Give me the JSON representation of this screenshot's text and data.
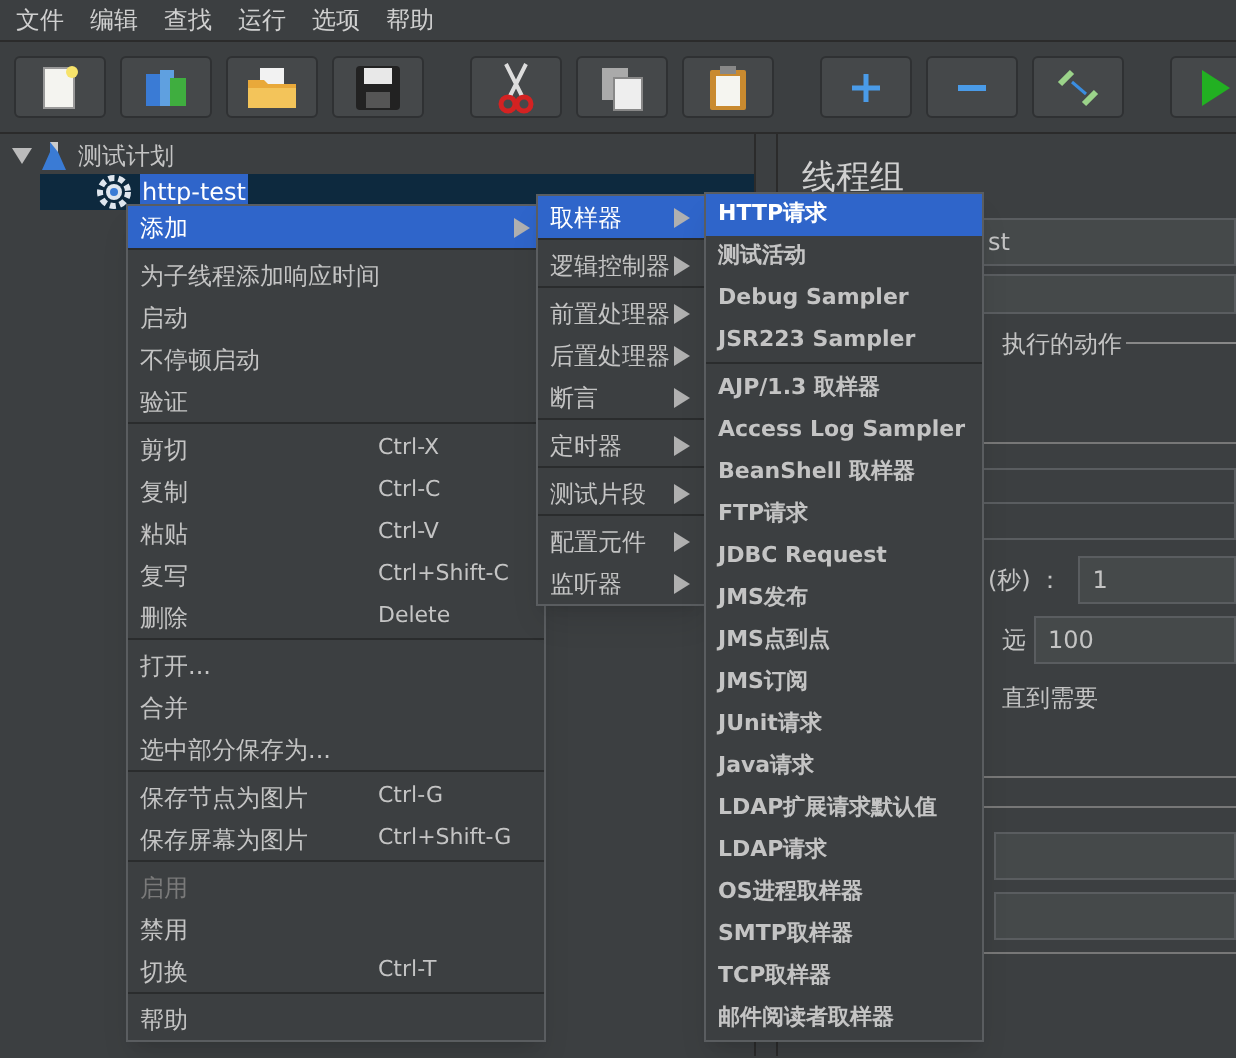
{
  "menubar": [
    "文件",
    "编辑",
    "查找",
    "运行",
    "选项",
    "帮助"
  ],
  "tree": [
    {
      "label": "测试计划",
      "kind": "plan",
      "expanded": true,
      "selected": false,
      "children": [
        {
          "label": "http-test",
          "kind": "threads",
          "selected": true
        }
      ]
    }
  ],
  "right_panel": {
    "title": "线程组",
    "name_field": {
      "value": "st"
    },
    "action_label": "执行的动作",
    "ramp_label": "(秒) ：",
    "ramp_field": {
      "value": "1"
    },
    "loop_label": "远",
    "loop_field": {
      "value": "100"
    },
    "delay_label": "直到需要"
  },
  "context_menu": {
    "groups": [
      [
        {
          "label": "添加",
          "has_submenu": true,
          "selected": true,
          "disabled": false
        }
      ],
      [
        {
          "label": "为子线程添加响应时间",
          "has_submenu": false,
          "selected": false,
          "disabled": false
        },
        {
          "label": "启动",
          "has_submenu": false,
          "selected": false,
          "disabled": false
        },
        {
          "label": "不停顿启动",
          "has_submenu": false,
          "selected": false,
          "disabled": false
        },
        {
          "label": "验证",
          "has_submenu": false,
          "selected": false,
          "disabled": false
        }
      ],
      [
        {
          "label": "剪切",
          "shortcut": "Ctrl-X",
          "has_submenu": false,
          "selected": false,
          "disabled": false
        },
        {
          "label": "复制",
          "shortcut": "Ctrl-C",
          "has_submenu": false,
          "selected": false,
          "disabled": false
        },
        {
          "label": "粘贴",
          "shortcut": "Ctrl-V",
          "has_submenu": false,
          "selected": false,
          "disabled": false
        },
        {
          "label": "复写",
          "shortcut": "Ctrl+Shift-C",
          "has_submenu": false,
          "selected": false,
          "disabled": false
        },
        {
          "label": "删除",
          "shortcut": "Delete",
          "has_submenu": false,
          "selected": false,
          "disabled": false
        }
      ],
      [
        {
          "label": "打开...",
          "has_submenu": false,
          "selected": false,
          "disabled": false
        },
        {
          "label": "合并",
          "has_submenu": false,
          "selected": false,
          "disabled": false
        },
        {
          "label": "选中部分保存为...",
          "has_submenu": false,
          "selected": false,
          "disabled": false
        }
      ],
      [
        {
          "label": "保存节点为图片",
          "shortcut": "Ctrl-G",
          "has_submenu": false,
          "selected": false,
          "disabled": false
        },
        {
          "label": "保存屏幕为图片",
          "shortcut": "Ctrl+Shift-G",
          "has_submenu": false,
          "selected": false,
          "disabled": false
        }
      ],
      [
        {
          "label": "启用",
          "has_submenu": false,
          "selected": false,
          "disabled": true
        },
        {
          "label": "禁用",
          "has_submenu": false,
          "selected": false,
          "disabled": false
        },
        {
          "label": "切换",
          "shortcut": "Ctrl-T",
          "has_submenu": false,
          "selected": false,
          "disabled": false
        }
      ],
      [
        {
          "label": "帮助",
          "has_submenu": false,
          "selected": false,
          "disabled": false
        }
      ]
    ]
  },
  "add_submenu": {
    "groups": [
      [
        {
          "label": "取样器",
          "has_submenu": true,
          "selected": true,
          "disabled": false
        }
      ],
      [
        {
          "label": "逻辑控制器",
          "has_submenu": true,
          "selected": false,
          "disabled": false
        }
      ],
      [
        {
          "label": "前置处理器",
          "has_submenu": true,
          "selected": false,
          "disabled": false
        },
        {
          "label": "后置处理器",
          "has_submenu": true,
          "selected": false,
          "disabled": false
        },
        {
          "label": "断言",
          "has_submenu": true,
          "selected": false,
          "disabled": false
        }
      ],
      [
        {
          "label": "定时器",
          "has_submenu": true,
          "selected": false,
          "disabled": false
        }
      ],
      [
        {
          "label": "测试片段",
          "has_submenu": true,
          "selected": false,
          "disabled": false
        }
      ],
      [
        {
          "label": "配置元件",
          "has_submenu": true,
          "selected": false,
          "disabled": false
        },
        {
          "label": "监听器",
          "has_submenu": true,
          "selected": false,
          "disabled": false
        }
      ]
    ]
  },
  "sampler_submenu": {
    "groups": [
      [
        {
          "label": "HTTP请求",
          "has_submenu": false,
          "selected": true,
          "disabled": false
        },
        {
          "label": "测试活动",
          "has_submenu": false,
          "selected": false,
          "disabled": false
        },
        {
          "label": "Debug Sampler",
          "has_submenu": false,
          "selected": false,
          "disabled": false
        },
        {
          "label": "JSR223 Sampler",
          "has_submenu": false,
          "selected": false,
          "disabled": false
        }
      ],
      [
        {
          "label": "AJP/1.3 取样器",
          "has_submenu": false,
          "selected": false,
          "disabled": false
        },
        {
          "label": "Access Log Sampler",
          "has_submenu": false,
          "selected": false,
          "disabled": false
        },
        {
          "label": "BeanShell 取样器",
          "has_submenu": false,
          "selected": false,
          "disabled": false
        },
        {
          "label": "FTP请求",
          "has_submenu": false,
          "selected": false,
          "disabled": false
        },
        {
          "label": "JDBC Request",
          "has_submenu": false,
          "selected": false,
          "disabled": false
        },
        {
          "label": "JMS发布",
          "has_submenu": false,
          "selected": false,
          "disabled": false
        },
        {
          "label": "JMS点到点",
          "has_submenu": false,
          "selected": false,
          "disabled": false
        },
        {
          "label": "JMS订阅",
          "has_submenu": false,
          "selected": false,
          "disabled": false
        },
        {
          "label": "JUnit请求",
          "has_submenu": false,
          "selected": false,
          "disabled": false
        },
        {
          "label": "Java请求",
          "has_submenu": false,
          "selected": false,
          "disabled": false
        },
        {
          "label": "LDAP扩展请求默认值",
          "has_submenu": false,
          "selected": false,
          "disabled": false
        },
        {
          "label": "LDAP请求",
          "has_submenu": false,
          "selected": false,
          "disabled": false
        },
        {
          "label": "OS进程取样器",
          "has_submenu": false,
          "selected": false,
          "disabled": false
        },
        {
          "label": "SMTP取样器",
          "has_submenu": false,
          "selected": false,
          "disabled": false
        },
        {
          "label": "TCP取样器",
          "has_submenu": false,
          "selected": false,
          "disabled": false
        },
        {
          "label": "邮件阅读者取样器",
          "has_submenu": false,
          "selected": false,
          "disabled": false
        }
      ]
    ]
  }
}
